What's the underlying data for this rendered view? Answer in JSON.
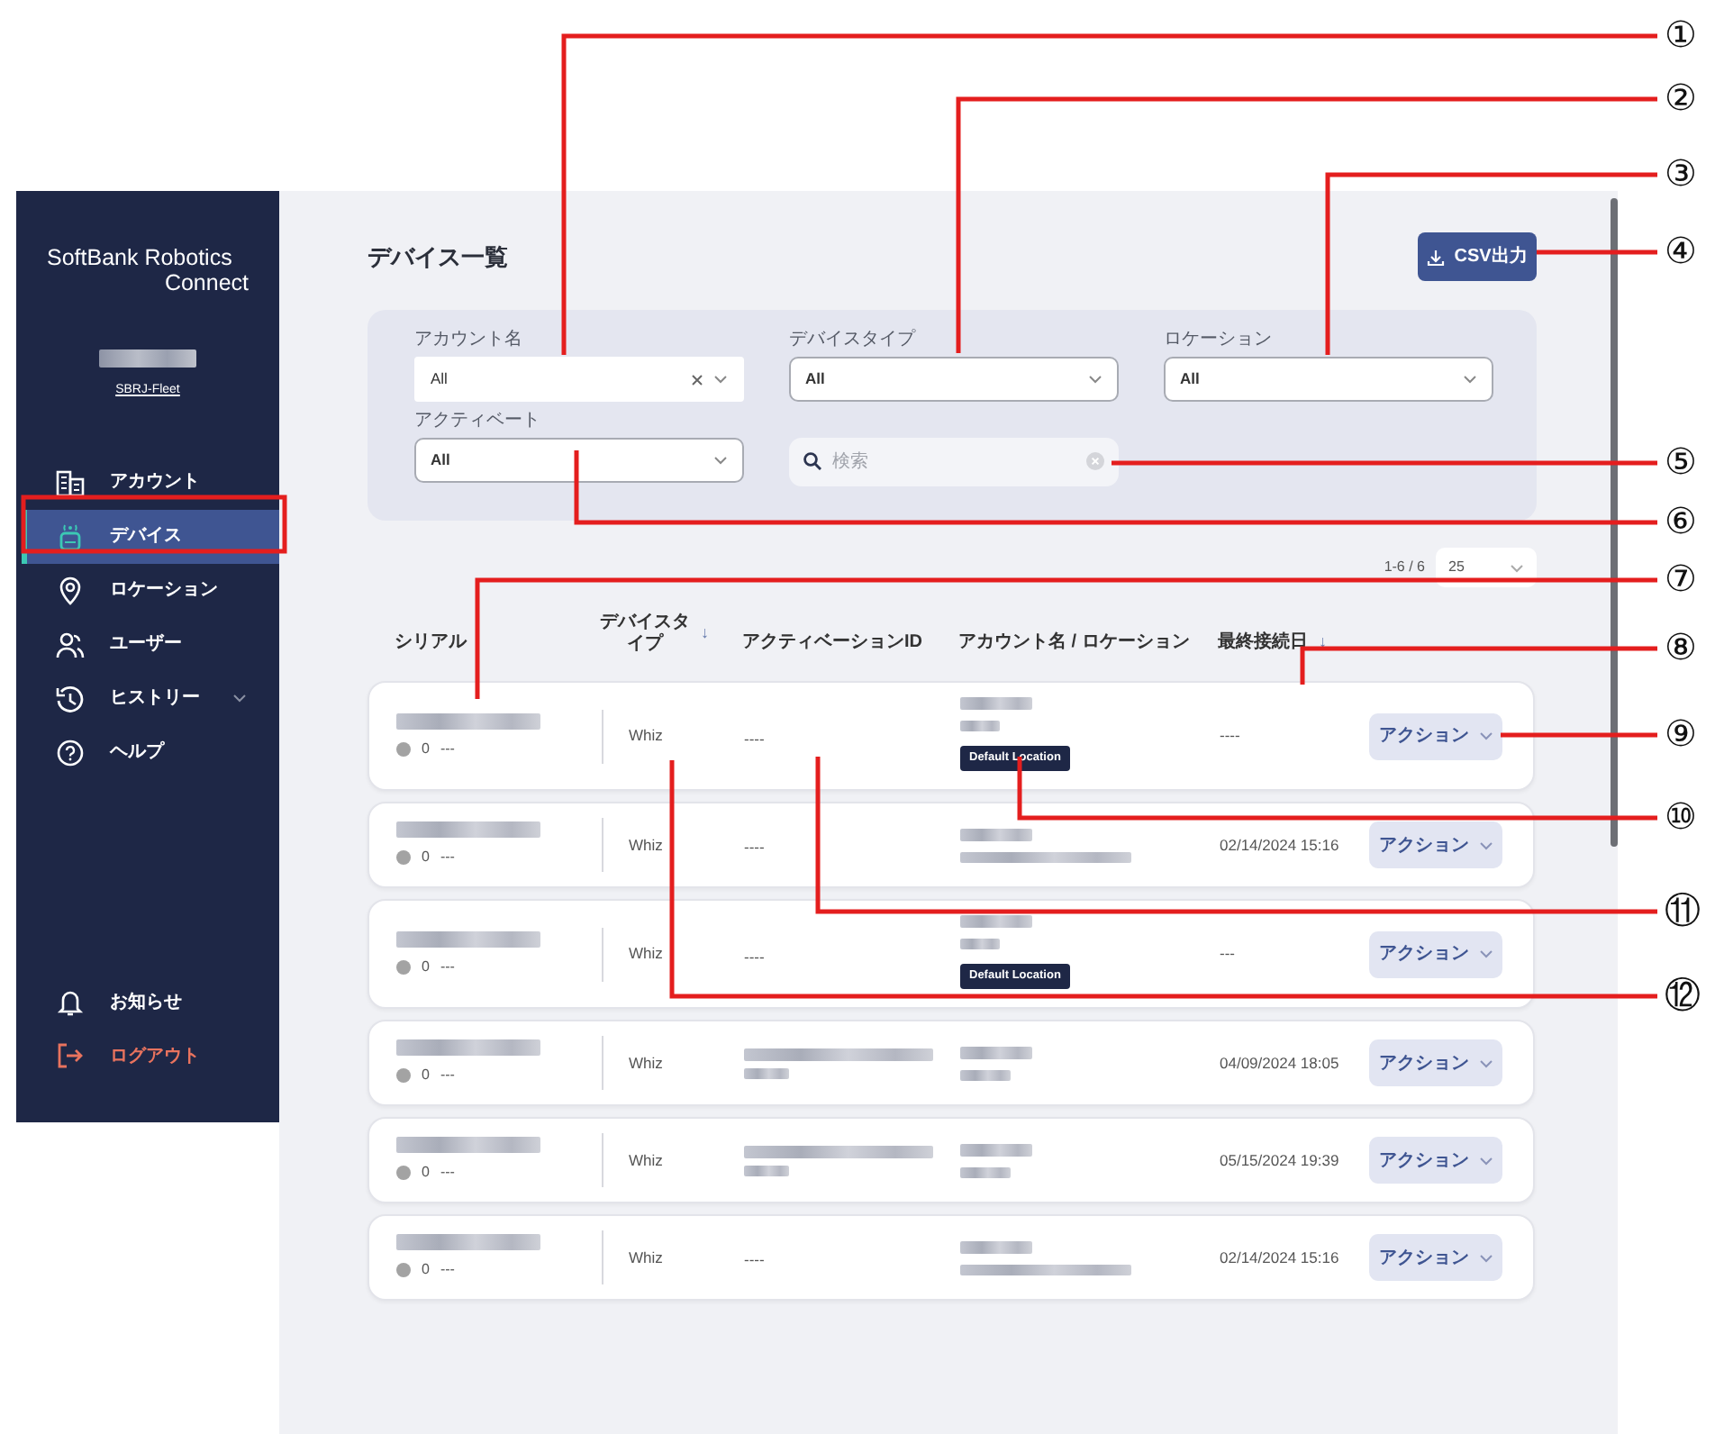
{
  "sidebar": {
    "brand": "SoftBank Robotics",
    "brand_sub": "Connect",
    "account_link": "SBRJ-Fleet",
    "items": [
      {
        "label": "アカウント",
        "selected": false,
        "expandable": false
      },
      {
        "label": "デバイス",
        "selected": true,
        "expandable": false
      },
      {
        "label": "ロケーション",
        "selected": false,
        "expandable": false
      },
      {
        "label": "ユーザー",
        "selected": false,
        "expandable": false
      },
      {
        "label": "ヒストリー",
        "selected": false,
        "expandable": true
      },
      {
        "label": "ヘルプ",
        "selected": false,
        "expandable": false
      }
    ],
    "footer_items": [
      {
        "kind": "notice",
        "label": "お知らせ"
      },
      {
        "kind": "logout",
        "label": "ログアウト"
      }
    ]
  },
  "page": {
    "title": "デバイス一覧",
    "export_button": "CSV出力"
  },
  "filters": [
    {
      "label": "アカウント名",
      "value": "All",
      "clearable": true
    },
    {
      "label": "デバイスタイプ",
      "value": "All",
      "clearable": false
    },
    {
      "label": "ロケーション",
      "value": "All",
      "clearable": false
    },
    {
      "label": "アクティベート",
      "value": "All",
      "clearable": false
    }
  ],
  "search": {
    "placeholder": "検索"
  },
  "pagination": {
    "range": "1-6 / 6",
    "page_size": "25"
  },
  "table": {
    "columns": [
      {
        "label": "シリアル"
      },
      {
        "label": "デバイスタイプ",
        "sort_arrow": "↓"
      },
      {
        "label": "アクティベーションID"
      },
      {
        "label": "アカウント名 / ロケーション"
      },
      {
        "label": "最終接続日",
        "sort_arrow": "↓"
      }
    ],
    "rows": [
      {
        "status_count": "0",
        "status_text": "---",
        "device_type": "Whiz",
        "activation_id": "----",
        "account_badge": "Default Location",
        "last_connected": "----",
        "action": "アクション"
      },
      {
        "status_count": "0",
        "status_text": "---",
        "device_type": "Whiz",
        "activation_id": "----",
        "last_connected": "02/14/2024 15:16",
        "action": "アクション"
      },
      {
        "status_count": "0",
        "status_text": "---",
        "device_type": "Whiz",
        "activation_id": "----",
        "account_badge": "Default Location",
        "last_connected": "---",
        "action": "アクション"
      },
      {
        "status_count": "0",
        "status_text": "---",
        "device_type": "Whiz",
        "last_connected": "04/09/2024 18:05",
        "action": "アクション"
      },
      {
        "status_count": "0",
        "status_text": "---",
        "device_type": "Whiz",
        "last_connected": "05/15/2024 19:39",
        "action": "アクション"
      },
      {
        "status_count": "0",
        "status_text": "---",
        "device_type": "Whiz",
        "activation_id": "----",
        "last_connected": "02/14/2024 15:16",
        "action": "アクション"
      }
    ]
  },
  "annotations": [
    {
      "label": "①"
    },
    {
      "label": "②"
    },
    {
      "label": "③"
    },
    {
      "label": "④"
    },
    {
      "label": "⑤"
    },
    {
      "label": "⑥"
    },
    {
      "label": "⑦"
    },
    {
      "label": "⑧"
    },
    {
      "label": "⑨"
    },
    {
      "label": "⑩"
    },
    {
      "label": "⑪"
    },
    {
      "label": "⑫"
    }
  ]
}
